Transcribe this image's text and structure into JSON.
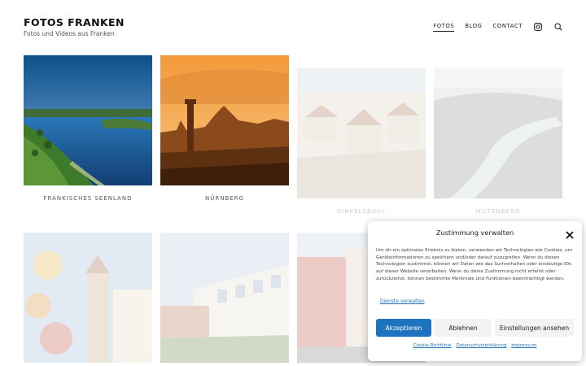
{
  "site": {
    "title": "FOTOS FRANKEN",
    "tagline": "Fotos und Videos aus Franken"
  },
  "nav": {
    "items": [
      {
        "label": "FOTOS",
        "active": true
      },
      {
        "label": "BLOG",
        "active": false
      },
      {
        "label": "CONTACT",
        "active": false
      }
    ],
    "instagram_icon": "instagram-icon",
    "search_icon": "search-icon"
  },
  "gallery": {
    "tiles": [
      {
        "label": "FRÄNKISCHES SEENLAND"
      },
      {
        "label": "NÜRNBERG"
      },
      {
        "label": "DINKELSBÜHL"
      },
      {
        "label": "MILTENBERG"
      }
    ]
  },
  "consent": {
    "title": "Zustimmung verwalten",
    "text": "Um dir ein optimales Erlebnis zu bieten, verwenden wir Technologien wie Cookies, um Geräteinformationen zu speichern und/oder darauf zuzugreifen. Wenn du diesen Technologien zustimmst, können wir Daten wie das Surfverhalten oder eindeutige IDs auf dieser Website verarbeiten. Wenn du deine Zustimmung nicht erteilst oder zurückziehst, können bestimmte Merkmale und Funktionen beeinträchtigt werden.",
    "manage_services": "Dienste verwalten",
    "accept": "Akzeptieren",
    "deny": "Ablehnen",
    "preferences": "Einstellungen ansehen",
    "footer": {
      "cookie_policy": "Cookie-Richtlinie",
      "privacy": "Datenschutzerklärung",
      "imprint": "Impressum"
    }
  },
  "colors": {
    "accent": "#1e73be"
  }
}
